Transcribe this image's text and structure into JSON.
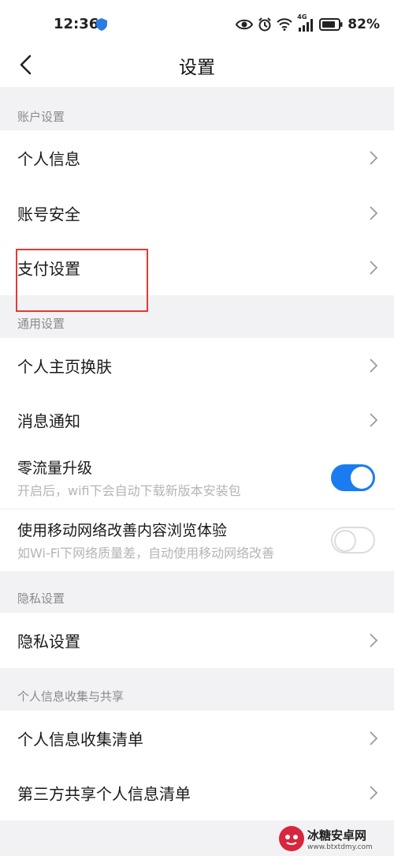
{
  "status_bar": {
    "time": "12:36",
    "battery": "82%",
    "network_label": "4G",
    "icons": [
      "shield-icon",
      "eye-icon",
      "alarm-icon",
      "wifi-icon",
      "signal-icon",
      "battery-icon"
    ]
  },
  "nav": {
    "back_icon": "chevron-left-icon",
    "title": "设置"
  },
  "sections": {
    "account": {
      "header": "账户设置",
      "items": [
        "个人信息",
        "账号安全",
        "支付设置"
      ]
    },
    "general": {
      "header": "通用设置",
      "items": [
        "个人主页换肤",
        "消息通知"
      ],
      "toggles": [
        {
          "title": "零流量升级",
          "subtitle": "开启后，wifi下会自动下载新版本安装包",
          "on": true
        },
        {
          "title": "使用移动网络改善内容浏览体验",
          "subtitle": "如Wi-Fi下网络质量差，自动使用移动网络改善",
          "on": false
        }
      ]
    },
    "privacy": {
      "header": "隐私设置",
      "items": [
        "隐私设置"
      ]
    },
    "collection": {
      "header": "个人信息收集与共享",
      "items": [
        "个人信息收集清单",
        "第三方共享个人信息清单"
      ]
    }
  },
  "watermark": {
    "title": "冰糖安卓网",
    "url": "www.btxtdmy.com"
  },
  "colors": {
    "accent": "#1a7cf0",
    "highlight": "#e53935",
    "background": "#f2f2f4"
  }
}
